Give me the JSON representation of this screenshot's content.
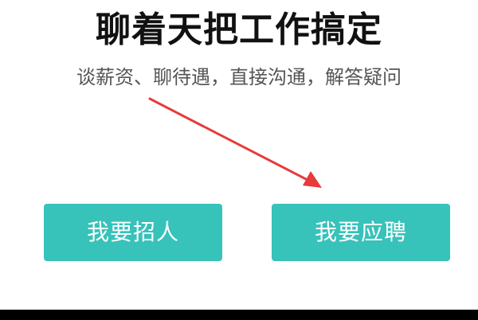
{
  "header": {
    "title": "聊着天把工作搞定",
    "subtitle": "谈薪资、聊待遇，直接沟通，解答疑问"
  },
  "actions": {
    "recruit_label": "我要招人",
    "apply_label": "我要应聘"
  },
  "colors": {
    "button_bg": "#37c2ba",
    "annotation_arrow": "#e8393b"
  },
  "annotation": {
    "icon": "red-arrow-pointing-to-apply-button"
  }
}
